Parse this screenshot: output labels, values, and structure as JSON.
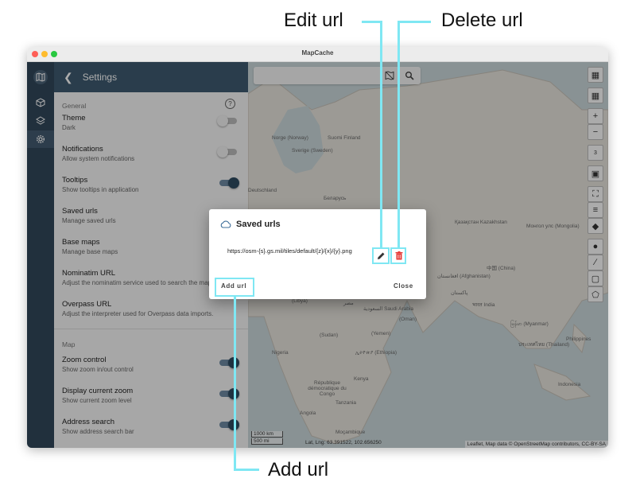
{
  "window": {
    "title": "MapCache"
  },
  "settings": {
    "header": "Settings",
    "general_label": "General",
    "map_label": "Map",
    "items": [
      {
        "title": "Theme",
        "subtitle": "Dark",
        "toggle": "off"
      },
      {
        "title": "Notifications",
        "subtitle": "Allow system notifications",
        "toggle": "off"
      },
      {
        "title": "Tooltips",
        "subtitle": "Show tooltips in application",
        "toggle": "on"
      },
      {
        "title": "Saved urls",
        "subtitle": "Manage saved urls"
      },
      {
        "title": "Base maps",
        "subtitle": "Manage base maps"
      },
      {
        "title": "Nominatim URL",
        "subtitle": "Adjust the nominatim service used to search the map."
      },
      {
        "title": "Overpass URL",
        "subtitle": "Adjust the interpreter used for Overpass data imports."
      }
    ],
    "map_items": [
      {
        "title": "Zoom control",
        "subtitle": "Show zoom in/out control",
        "toggle": "on"
      },
      {
        "title": "Display current zoom",
        "subtitle": "Show current zoom level",
        "toggle": "on"
      },
      {
        "title": "Address search",
        "subtitle": "Show address search bar",
        "toggle": "on"
      }
    ]
  },
  "map": {
    "zoom_level": "3",
    "scale_km": "1000 km",
    "scale_mi": "500 mi",
    "latlng": "Lat, Lng: 63.391522, 102.656250",
    "attribution": "Leaflet, Map data © OpenStreetMap contributors, CC-BY-SA",
    "labels": [
      "Norge (Norway)",
      "Sverige (Sweden)",
      "Suomi Finland",
      "Беларусь",
      "Deutschland",
      "Қазақстан Kazakhstan",
      "Монгол улс (Mongolia)",
      "中国 (China)",
      "افغانستان (Afghanistan)",
      "پاکستان",
      "भारत India",
      "မြန်မာ (Myanmar)",
      "ประเทศไทย (Thailand)",
      "Philippines",
      "Indonesia",
      "(Libya)",
      "مصر",
      "السعودية Saudi Arabia",
      "(Oman)",
      "(Yemen)",
      "Nigeria",
      "(Sudan)",
      "ኢትዮጵያ (Ethiopia)",
      "Kenya",
      "République démocratique du Congo",
      "Angola",
      "Tanzania",
      "Moçambique"
    ]
  },
  "dialog": {
    "title": "Saved urls",
    "url": "https://osm-{s}.gs.mil/tiles/default/{z}/{x}/{y}.png",
    "add_label": "Add url",
    "close_label": "Close"
  },
  "callouts": {
    "edit": "Edit url",
    "delete": "Delete url",
    "add": "Add url"
  },
  "colors": {
    "highlight": "#7fe7f3",
    "header": "#3f5a70",
    "rail": "#31475a",
    "delete": "#e53935"
  }
}
